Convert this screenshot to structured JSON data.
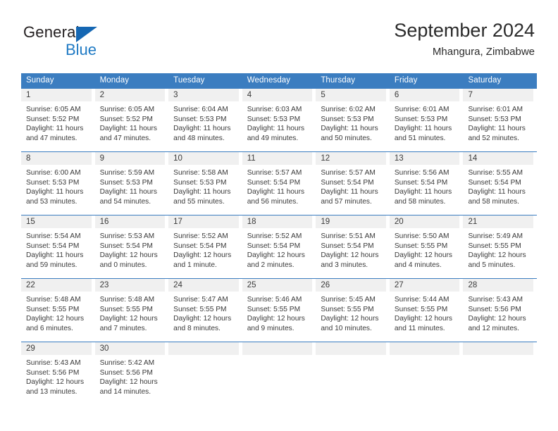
{
  "brand": {
    "line1": "General",
    "line2": "Blue",
    "triangle_color": "#1567b3",
    "blue_text_color": "#1f7ac4"
  },
  "header": {
    "title": "September 2024",
    "subtitle": "Mhangura, Zimbabwe"
  },
  "theme": {
    "header_row_bg": "#3b7dc0",
    "daynum_bg": "#f0f0f0",
    "separator": "#3b7dc0"
  },
  "labels": {
    "sunrise_prefix": "Sunrise:",
    "sunset_prefix": "Sunset:",
    "daylight_prefix": "Daylight:"
  },
  "weekday_headers": [
    "Sunday",
    "Monday",
    "Tuesday",
    "Wednesday",
    "Thursday",
    "Friday",
    "Saturday"
  ],
  "weeks": [
    [
      {
        "day": "1",
        "sunrise": "Sunrise: 6:05 AM",
        "sunset": "Sunset: 5:52 PM",
        "daylight_l1": "Daylight: 11 hours",
        "daylight_l2": "and 47 minutes."
      },
      {
        "day": "2",
        "sunrise": "Sunrise: 6:05 AM",
        "sunset": "Sunset: 5:52 PM",
        "daylight_l1": "Daylight: 11 hours",
        "daylight_l2": "and 47 minutes."
      },
      {
        "day": "3",
        "sunrise": "Sunrise: 6:04 AM",
        "sunset": "Sunset: 5:53 PM",
        "daylight_l1": "Daylight: 11 hours",
        "daylight_l2": "and 48 minutes."
      },
      {
        "day": "4",
        "sunrise": "Sunrise: 6:03 AM",
        "sunset": "Sunset: 5:53 PM",
        "daylight_l1": "Daylight: 11 hours",
        "daylight_l2": "and 49 minutes."
      },
      {
        "day": "5",
        "sunrise": "Sunrise: 6:02 AM",
        "sunset": "Sunset: 5:53 PM",
        "daylight_l1": "Daylight: 11 hours",
        "daylight_l2": "and 50 minutes."
      },
      {
        "day": "6",
        "sunrise": "Sunrise: 6:01 AM",
        "sunset": "Sunset: 5:53 PM",
        "daylight_l1": "Daylight: 11 hours",
        "daylight_l2": "and 51 minutes."
      },
      {
        "day": "7",
        "sunrise": "Sunrise: 6:01 AM",
        "sunset": "Sunset: 5:53 PM",
        "daylight_l1": "Daylight: 11 hours",
        "daylight_l2": "and 52 minutes."
      }
    ],
    [
      {
        "day": "8",
        "sunrise": "Sunrise: 6:00 AM",
        "sunset": "Sunset: 5:53 PM",
        "daylight_l1": "Daylight: 11 hours",
        "daylight_l2": "and 53 minutes."
      },
      {
        "day": "9",
        "sunrise": "Sunrise: 5:59 AM",
        "sunset": "Sunset: 5:53 PM",
        "daylight_l1": "Daylight: 11 hours",
        "daylight_l2": "and 54 minutes."
      },
      {
        "day": "10",
        "sunrise": "Sunrise: 5:58 AM",
        "sunset": "Sunset: 5:53 PM",
        "daylight_l1": "Daylight: 11 hours",
        "daylight_l2": "and 55 minutes."
      },
      {
        "day": "11",
        "sunrise": "Sunrise: 5:57 AM",
        "sunset": "Sunset: 5:54 PM",
        "daylight_l1": "Daylight: 11 hours",
        "daylight_l2": "and 56 minutes."
      },
      {
        "day": "12",
        "sunrise": "Sunrise: 5:57 AM",
        "sunset": "Sunset: 5:54 PM",
        "daylight_l1": "Daylight: 11 hours",
        "daylight_l2": "and 57 minutes."
      },
      {
        "day": "13",
        "sunrise": "Sunrise: 5:56 AM",
        "sunset": "Sunset: 5:54 PM",
        "daylight_l1": "Daylight: 11 hours",
        "daylight_l2": "and 58 minutes."
      },
      {
        "day": "14",
        "sunrise": "Sunrise: 5:55 AM",
        "sunset": "Sunset: 5:54 PM",
        "daylight_l1": "Daylight: 11 hours",
        "daylight_l2": "and 58 minutes."
      }
    ],
    [
      {
        "day": "15",
        "sunrise": "Sunrise: 5:54 AM",
        "sunset": "Sunset: 5:54 PM",
        "daylight_l1": "Daylight: 11 hours",
        "daylight_l2": "and 59 minutes."
      },
      {
        "day": "16",
        "sunrise": "Sunrise: 5:53 AM",
        "sunset": "Sunset: 5:54 PM",
        "daylight_l1": "Daylight: 12 hours",
        "daylight_l2": "and 0 minutes."
      },
      {
        "day": "17",
        "sunrise": "Sunrise: 5:52 AM",
        "sunset": "Sunset: 5:54 PM",
        "daylight_l1": "Daylight: 12 hours",
        "daylight_l2": "and 1 minute."
      },
      {
        "day": "18",
        "sunrise": "Sunrise: 5:52 AM",
        "sunset": "Sunset: 5:54 PM",
        "daylight_l1": "Daylight: 12 hours",
        "daylight_l2": "and 2 minutes."
      },
      {
        "day": "19",
        "sunrise": "Sunrise: 5:51 AM",
        "sunset": "Sunset: 5:54 PM",
        "daylight_l1": "Daylight: 12 hours",
        "daylight_l2": "and 3 minutes."
      },
      {
        "day": "20",
        "sunrise": "Sunrise: 5:50 AM",
        "sunset": "Sunset: 5:55 PM",
        "daylight_l1": "Daylight: 12 hours",
        "daylight_l2": "and 4 minutes."
      },
      {
        "day": "21",
        "sunrise": "Sunrise: 5:49 AM",
        "sunset": "Sunset: 5:55 PM",
        "daylight_l1": "Daylight: 12 hours",
        "daylight_l2": "and 5 minutes."
      }
    ],
    [
      {
        "day": "22",
        "sunrise": "Sunrise: 5:48 AM",
        "sunset": "Sunset: 5:55 PM",
        "daylight_l1": "Daylight: 12 hours",
        "daylight_l2": "and 6 minutes."
      },
      {
        "day": "23",
        "sunrise": "Sunrise: 5:48 AM",
        "sunset": "Sunset: 5:55 PM",
        "daylight_l1": "Daylight: 12 hours",
        "daylight_l2": "and 7 minutes."
      },
      {
        "day": "24",
        "sunrise": "Sunrise: 5:47 AM",
        "sunset": "Sunset: 5:55 PM",
        "daylight_l1": "Daylight: 12 hours",
        "daylight_l2": "and 8 minutes."
      },
      {
        "day": "25",
        "sunrise": "Sunrise: 5:46 AM",
        "sunset": "Sunset: 5:55 PM",
        "daylight_l1": "Daylight: 12 hours",
        "daylight_l2": "and 9 minutes."
      },
      {
        "day": "26",
        "sunrise": "Sunrise: 5:45 AM",
        "sunset": "Sunset: 5:55 PM",
        "daylight_l1": "Daylight: 12 hours",
        "daylight_l2": "and 10 minutes."
      },
      {
        "day": "27",
        "sunrise": "Sunrise: 5:44 AM",
        "sunset": "Sunset: 5:55 PM",
        "daylight_l1": "Daylight: 12 hours",
        "daylight_l2": "and 11 minutes."
      },
      {
        "day": "28",
        "sunrise": "Sunrise: 5:43 AM",
        "sunset": "Sunset: 5:56 PM",
        "daylight_l1": "Daylight: 12 hours",
        "daylight_l2": "and 12 minutes."
      }
    ],
    [
      {
        "day": "29",
        "sunrise": "Sunrise: 5:43 AM",
        "sunset": "Sunset: 5:56 PM",
        "daylight_l1": "Daylight: 12 hours",
        "daylight_l2": "and 13 minutes."
      },
      {
        "day": "30",
        "sunrise": "Sunrise: 5:42 AM",
        "sunset": "Sunset: 5:56 PM",
        "daylight_l1": "Daylight: 12 hours",
        "daylight_l2": "and 14 minutes."
      },
      {
        "day": "",
        "sunrise": "",
        "sunset": "",
        "daylight_l1": "",
        "daylight_l2": ""
      },
      {
        "day": "",
        "sunrise": "",
        "sunset": "",
        "daylight_l1": "",
        "daylight_l2": ""
      },
      {
        "day": "",
        "sunrise": "",
        "sunset": "",
        "daylight_l1": "",
        "daylight_l2": ""
      },
      {
        "day": "",
        "sunrise": "",
        "sunset": "",
        "daylight_l1": "",
        "daylight_l2": ""
      },
      {
        "day": "",
        "sunrise": "",
        "sunset": "",
        "daylight_l1": "",
        "daylight_l2": ""
      }
    ]
  ]
}
